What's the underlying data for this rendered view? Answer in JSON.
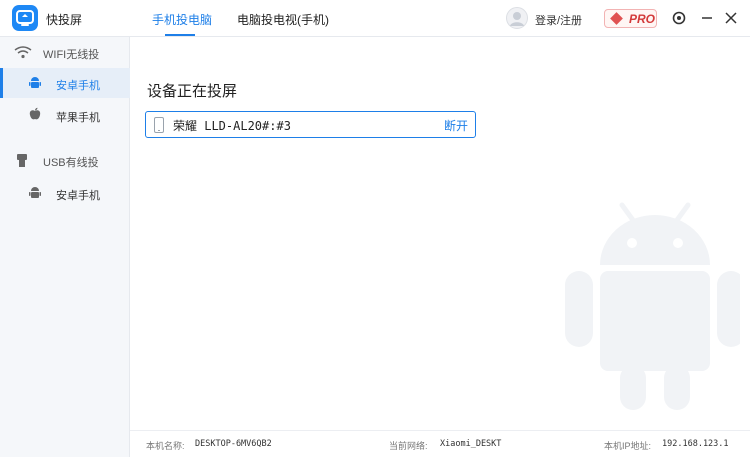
{
  "app": {
    "name": "快投屏",
    "brand_color": "#1e7fe8"
  },
  "tabs": [
    {
      "label": "手机投电脑",
      "active": true
    },
    {
      "label": "电脑投电视(手机)",
      "active": false
    }
  ],
  "header": {
    "login_label": "登录/注册",
    "pro_label": "PRO"
  },
  "sidebar": {
    "wifi_header": "WIFI无线投",
    "wifi_items": [
      {
        "label": "安卓手机",
        "icon": "android-icon",
        "active": true
      },
      {
        "label": "苹果手机",
        "icon": "apple-icon",
        "active": false
      }
    ],
    "usb_header": "USB有线投",
    "usb_items": [
      {
        "label": "安卓手机",
        "icon": "android-icon",
        "active": false
      }
    ]
  },
  "main": {
    "title": "设备正在投屏",
    "device": {
      "name": "荣耀 LLD-AL20#:#3",
      "action_label": "断开"
    }
  },
  "footer": {
    "computer_name_label": "本机名称:",
    "computer_name_value": "DESKTOP-6MV6QB2",
    "network_label": "当前网络:",
    "network_value": "Xiaomi_DESKT",
    "ip_label": "本机IP地址:",
    "ip_value": "192.168.123.1"
  }
}
